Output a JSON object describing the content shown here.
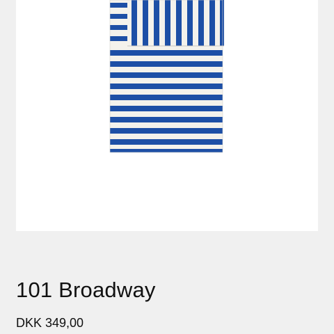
{
  "product": {
    "title": "101 Broadway",
    "price": "DKK 349,00",
    "image": {
      "icon": "striped-textile-image",
      "stripe_color": "#1d4fa6",
      "base_color": "#f4f2ec"
    }
  }
}
